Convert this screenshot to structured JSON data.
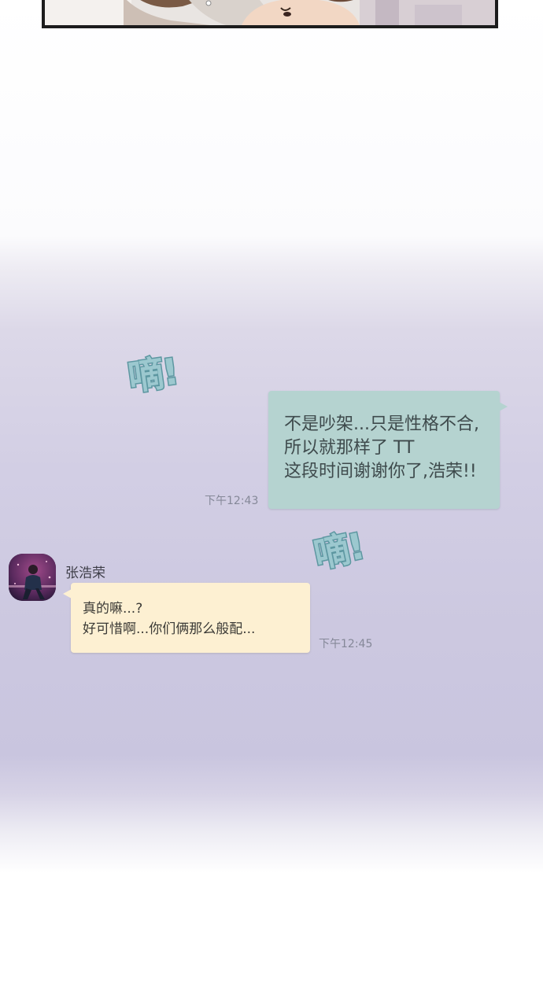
{
  "sound_effects": [
    {
      "text": "嘀!"
    },
    {
      "text": "嘀!"
    }
  ],
  "outgoing_message": {
    "lines": [
      "不是吵架...只是性格不合,",
      "所以就那样了 TT",
      "这段时间谢谢你了,浩荣!!"
    ],
    "time": "下午12:43",
    "bubble_color": "#b5d3d0"
  },
  "incoming_message": {
    "sender": "张浩荣",
    "lines": [
      "真的嘛...?",
      "好可惜啊...你们俩那么般配..."
    ],
    "time": "下午12:45",
    "bubble_color": "#fdf0d2"
  },
  "colors": {
    "sfx_fill": "#9cc8cf",
    "sfx_stroke": "#5d97a1",
    "background_lavender": "#ccc8e0"
  }
}
